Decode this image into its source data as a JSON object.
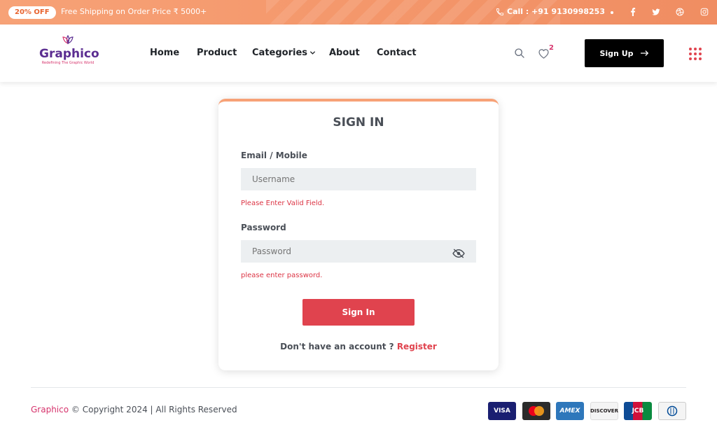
{
  "topbar": {
    "badge": "20% OFF",
    "shipping": "Free Shipping on Order Price ₹ 5000+",
    "call": "Call : +91 9130998253"
  },
  "header": {
    "brand_word": "Graphico",
    "brand_tagline": "Redefining The Graphic World",
    "nav": [
      "Home",
      "Product",
      "Categories",
      "About",
      "Contact"
    ],
    "wishlist_count": "2",
    "signup_label": "Sign Up"
  },
  "signin": {
    "title": "SIGN IN",
    "email_label": "Email / Mobile",
    "email_placeholder": "Username",
    "email_error": "Please Enter Valid Field.",
    "password_label": "Password",
    "password_placeholder": "Password",
    "password_error": "please enter password.",
    "submit_label": "Sign In",
    "no_account_text": "Don't have an account ?",
    "register_label": "Register"
  },
  "footer": {
    "brand": "Graphico",
    "copyright": "© Copyright 2024 | All Rights Reserved",
    "payments": [
      "VISA",
      "mastercard",
      "AMEX",
      "DISCOVER",
      "JCB",
      "Diners Club"
    ]
  },
  "colors": {
    "accent": "#e0434e",
    "topbar": "#f4976b",
    "brand": "#d6336c"
  }
}
